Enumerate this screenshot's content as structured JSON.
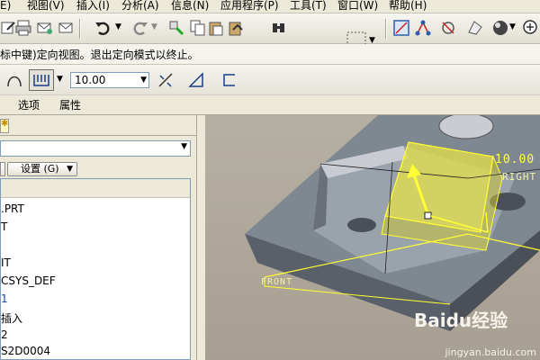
{
  "menu": {
    "items": [
      "E)",
      "视图(V)",
      "插入(I)",
      "分析(A)",
      "信息(N)",
      "应用程序(P)",
      "工具(T)",
      "窗口(W)",
      "帮助(H)"
    ]
  },
  "message": {
    "text": "标中键)定向视图。退出定向模式以终止。"
  },
  "dashboard": {
    "value": "10.00",
    "tabs": [
      "选项",
      "属性"
    ]
  },
  "leftpanel": {
    "settings_label": "设置 (G)",
    "tree": [
      ".PRT",
      "T",
      "",
      "IT",
      "CSYS_DEF",
      "1",
      "插入",
      "2",
      "S2D0004"
    ]
  },
  "viewport": {
    "dim_value": "10.00",
    "right_label": "RIGHT",
    "front_label": "FRONT"
  },
  "watermark": {
    "brand": "Baidu经验",
    "url": "jingyan.baidu.com"
  },
  "colors": {
    "viewport_bg": "#b0aa9c",
    "highlight": "#ffff33",
    "part": "#8e96a0"
  }
}
